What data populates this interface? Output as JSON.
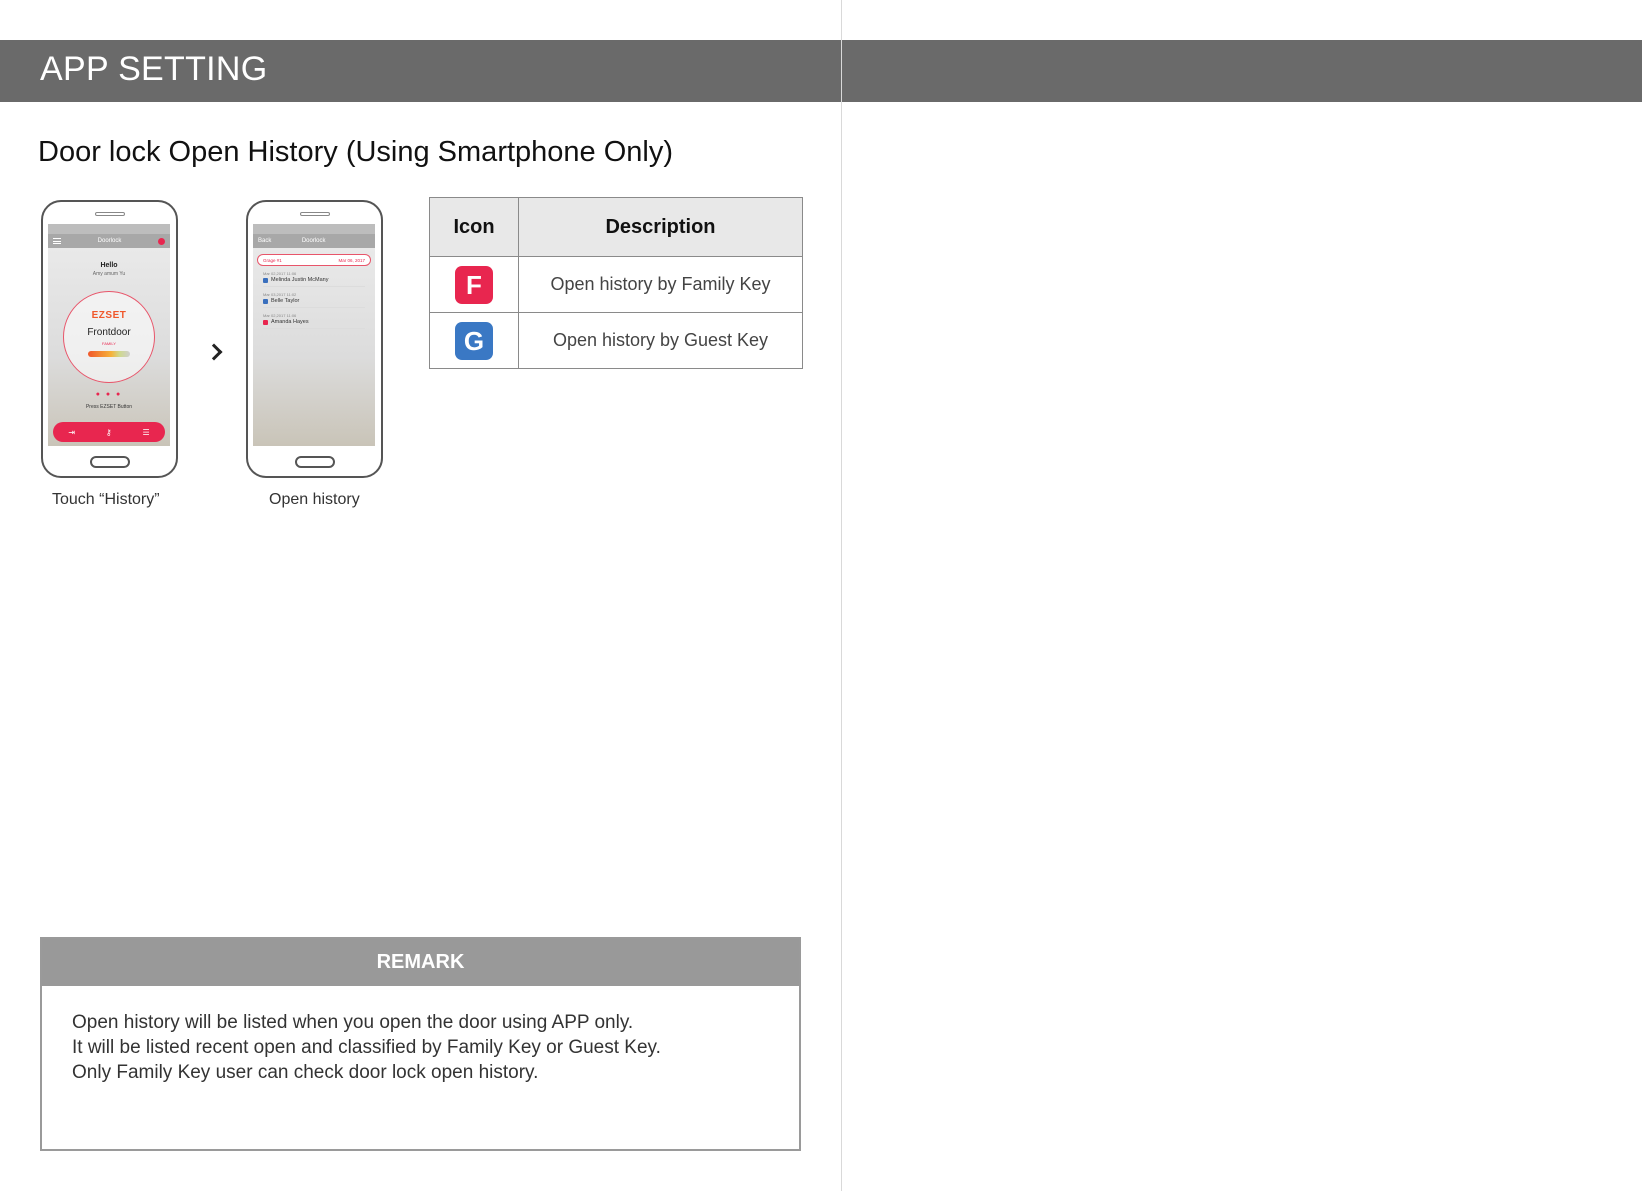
{
  "header": {
    "title": "APP SETTING"
  },
  "section": {
    "title": "Door lock Open History (Using Smartphone Only)"
  },
  "phone1": {
    "nav_title": "Doorlock",
    "hello": "Hello",
    "user_name": "Amy amum Yu",
    "brand": "EZSET",
    "lock_name": "Frontdoor",
    "lock_role": "FAMILY",
    "dots": "● ● ●",
    "press_text": "Press  EZSET  Button",
    "caption": "Touch “History”"
  },
  "phone2": {
    "nav_back": "Back",
    "nav_title": "Doorlock",
    "filter_label": "Grage #1",
    "filter_date": "Mar 06, 2017",
    "items": [
      {
        "date": "Mar 02,2017  11:06",
        "name": "Melinda Justin McMany",
        "key": "G"
      },
      {
        "date": "Mar 03,2017  11:02",
        "name": "Belle Taylor",
        "key": "G"
      },
      {
        "date": "Mar 02,2017  11:06",
        "name": "Amanda Hayes",
        "key": "F"
      }
    ],
    "caption": "Open history"
  },
  "table": {
    "headers": {
      "icon": "Icon",
      "description": "Description"
    },
    "rows": [
      {
        "icon_letter": "F",
        "icon_color": "#e8264f",
        "icon_name": "family-key-icon",
        "description": "Open history by Family Key"
      },
      {
        "icon_letter": "G",
        "icon_color": "#3a78c4",
        "icon_name": "guest-key-icon",
        "description": "Open history by Guest Key"
      }
    ]
  },
  "remark": {
    "title": "REMARK",
    "lines": [
      "Open history will be listed when you open the door using APP only.",
      "It will be listed recent open and classified by Family Key or Guest Key.",
      "Only Family Key user can check door lock open history."
    ]
  }
}
